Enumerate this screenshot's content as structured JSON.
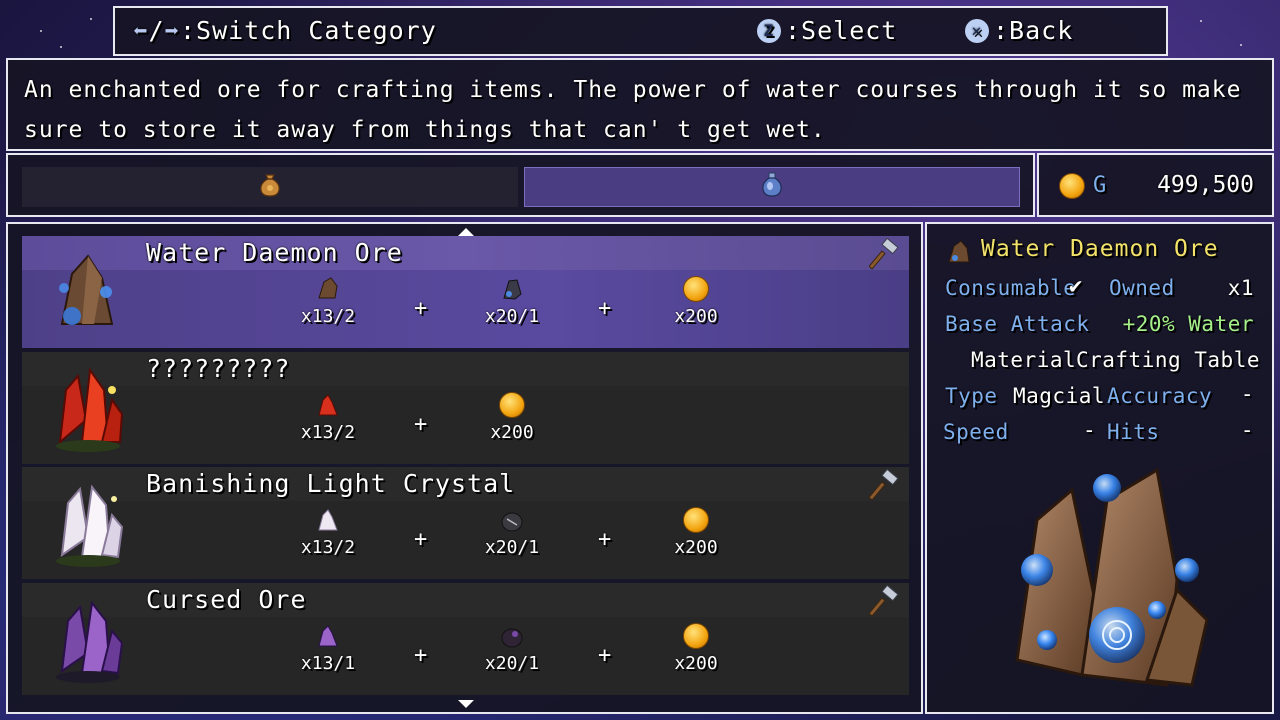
{
  "header": {
    "switch_label": ":Switch Category",
    "select_key": "Z",
    "select_label": ":Select",
    "back_key": "✕",
    "back_label": ":Back"
  },
  "description": "An enchanted ore for crafting items. The power of water courses through it so make sure to store it away from things that can' t get wet.",
  "categories": [
    {
      "icon": "pouch-icon",
      "active": false
    },
    {
      "icon": "potion-icon",
      "active": true
    }
  ],
  "gold": {
    "label": "G",
    "amount": "499,500"
  },
  "recipes": [
    {
      "name": "Water Daemon Ore",
      "craftable": true,
      "selected": true,
      "ingredients": [
        {
          "icon": "brown-ore-icon",
          "qty": "x13/2"
        },
        {
          "icon": "dark-ore-icon",
          "qty": "x20/1"
        },
        {
          "icon": "gold-coin-icon",
          "qty": "x200"
        }
      ]
    },
    {
      "name": "?????????",
      "craftable": false,
      "selected": false,
      "ingredients": [
        {
          "icon": "red-crystal-icon",
          "qty": "x13/2"
        },
        {
          "icon": "gold-coin-icon",
          "qty": "x200"
        }
      ]
    },
    {
      "name": "Banishing Light Crystal",
      "craftable": true,
      "selected": false,
      "ingredients": [
        {
          "icon": "white-crystal-icon",
          "qty": "x13/2"
        },
        {
          "icon": "dark-stone-icon",
          "qty": "x20/1"
        },
        {
          "icon": "gold-coin-icon",
          "qty": "x200"
        }
      ]
    },
    {
      "name": "Cursed Ore",
      "craftable": true,
      "selected": false,
      "ingredients": [
        {
          "icon": "purple-crystal-icon",
          "qty": "x13/1"
        },
        {
          "icon": "dark-purple-stone-icon",
          "qty": "x20/1"
        },
        {
          "icon": "gold-coin-icon",
          "qty": "x200"
        }
      ]
    }
  ],
  "detail": {
    "title": "Water Daemon Ore",
    "consumable_label": "Consumable",
    "consumable_check": "✔",
    "owned_label": "Owned",
    "owned_value": "x1",
    "base_attack_label": "Base Attack",
    "base_attack_value": "+20% Water",
    "material_label": "Material",
    "material_value": "Crafting Table",
    "type_label": "Type",
    "type_value": "Magcial",
    "accuracy_label": "Accuracy",
    "accuracy_value": "-",
    "speed_label": "Speed",
    "speed_value": "-",
    "hits_label": "Hits",
    "hits_value": "-"
  },
  "colors": {
    "label_blue": "#7fb0ee",
    "title_yellow": "#f4e36a",
    "bonus_green": "#a6f08a",
    "selected_row": "#5c4c9a"
  }
}
